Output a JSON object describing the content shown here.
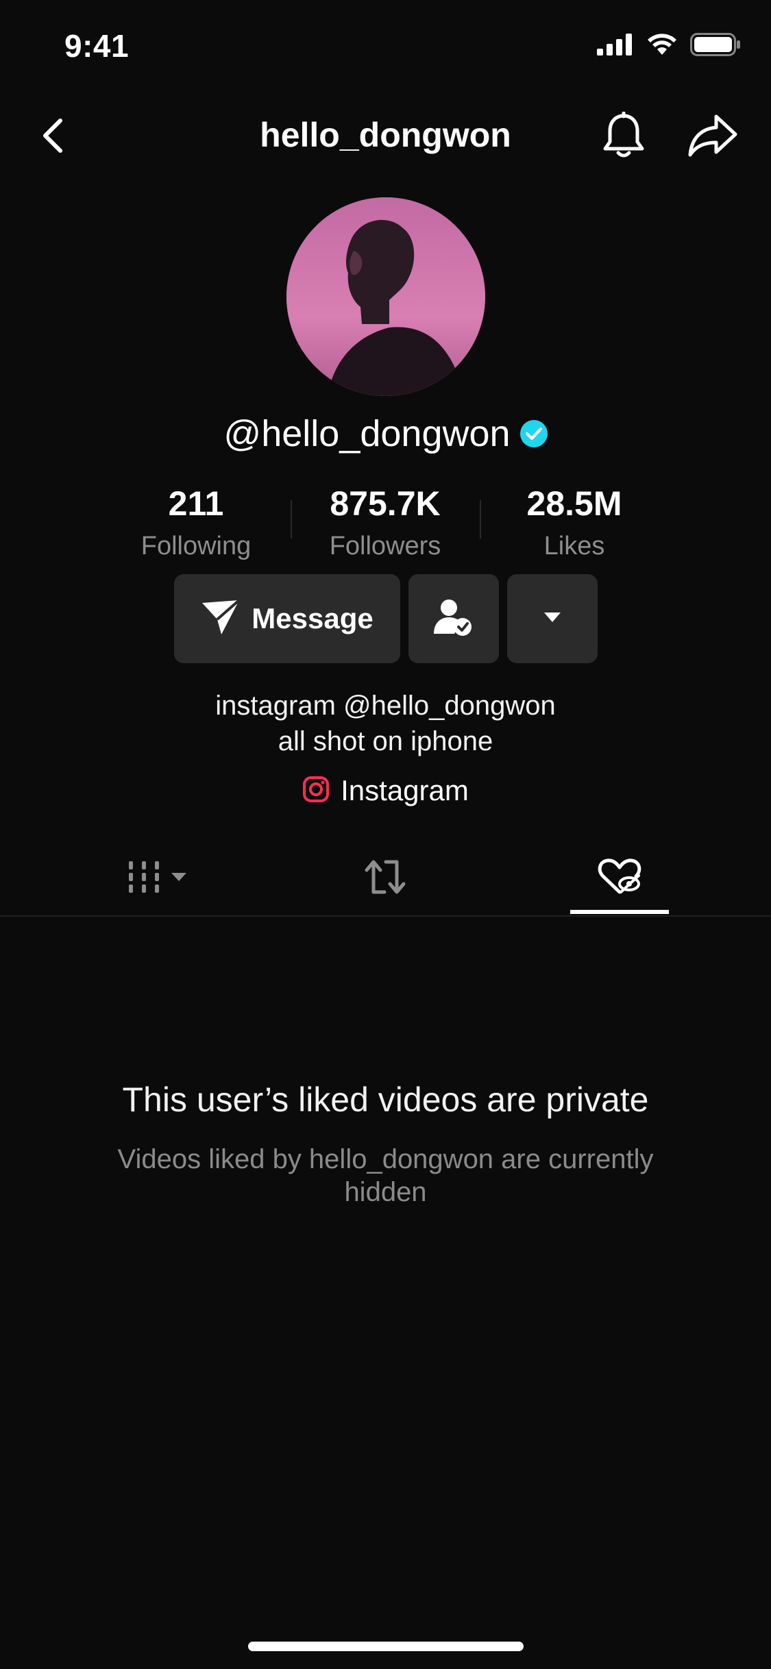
{
  "status_bar": {
    "time": "9:41"
  },
  "nav": {
    "title": "hello_dongwon",
    "back_icon": "chevron-left-icon",
    "bell_icon": "bell-icon",
    "share_icon": "share-arrow-icon"
  },
  "profile": {
    "handle": "@hello_dongwon",
    "verified": true,
    "avatar_colors": [
      "#e07ab4",
      "#b55c95",
      "#7a3f6c"
    ],
    "stats": [
      {
        "value": "211",
        "label": "Following"
      },
      {
        "value": "875.7K",
        "label": "Followers"
      },
      {
        "value": "28.5M",
        "label": "Likes"
      }
    ],
    "actions": {
      "message_label": "Message",
      "message_icon": "paper-plane-icon",
      "friends_icon": "user-check-icon",
      "more_icon": "caret-down-icon"
    },
    "bio_lines": [
      "instagram @hello_dongwon",
      "all shot on iphone"
    ],
    "link": {
      "label": "Instagram",
      "icon": "instagram-icon",
      "color": "#fe2c55"
    }
  },
  "tabs": [
    {
      "name": "videos",
      "icon": "grid-icon",
      "active": false
    },
    {
      "name": "reposts",
      "icon": "repost-icon",
      "active": false
    },
    {
      "name": "liked",
      "icon": "heart-hidden-icon",
      "active": true
    }
  ],
  "empty_state": {
    "title": "This user’s liked videos are private",
    "subtitle": "Videos liked by hello_dongwon are currently hidden"
  },
  "colors": {
    "background": "#0b0b0b",
    "button_bg": "#2b2b2b",
    "muted_text": "#8e8e8e",
    "verified": "#20d5ec"
  }
}
